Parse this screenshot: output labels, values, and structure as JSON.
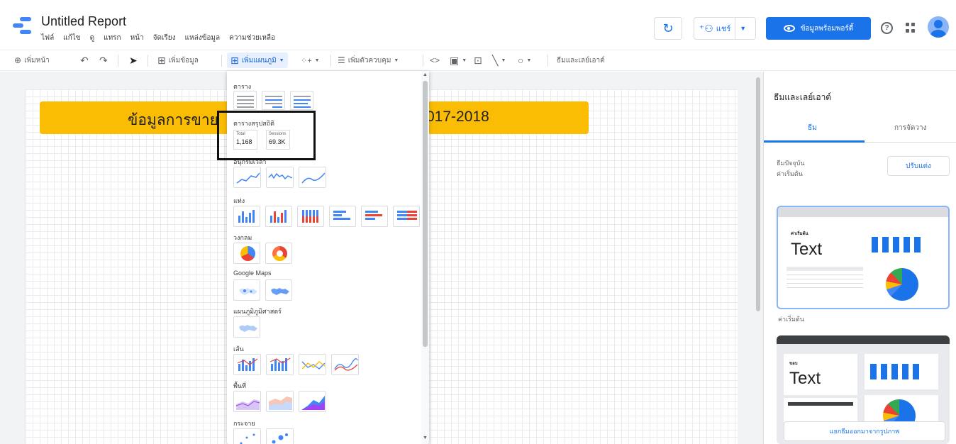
{
  "header": {
    "title": "Untitled Report",
    "menu": [
      "ไฟล์",
      "แก้ไข",
      "ดู",
      "แทรก",
      "หน้า",
      "จัดเรียง",
      "แหล่งข้อมูล",
      "ความช่วยเหลือ"
    ],
    "share_label": "แชร์",
    "view_label": "ข้อมูลพร้อมพอร์ตี้"
  },
  "toolbar": {
    "add_page": "เพิ่มหน้า",
    "add_data": "เพิ่มข้อมูล",
    "add_chart": "เพิ่มแผนภูมิ",
    "add_control": "เพิ่มตัวควบคุม",
    "theme_layout": "ธีมและเลย์เอาต์"
  },
  "canvas": {
    "banner_left": "ข้อมูลการขาย",
    "banner_right": "017-2018"
  },
  "chart_menu": {
    "sections": {
      "table": "ตาราง",
      "scorecard": "ตารางสรุปสถิติ",
      "timeseries": "อนุกรมเวลา",
      "bar": "แท่ง",
      "pie": "วงกลม",
      "google_maps": "Google Maps",
      "geo": "แผนภูมิภูมิศาสตร์",
      "line": "เส้น",
      "area": "พื้นที่",
      "scatter": "กระจาย"
    },
    "scorecard_1": {
      "label": "Total",
      "value": "1,168"
    },
    "scorecard_2": {
      "label": "Sessions",
      "value": "69.3K"
    }
  },
  "side_panel": {
    "title": "ธีมและเลย์เอาต์",
    "tab_theme": "ธีม",
    "tab_layout": "การจัดวาง",
    "current_theme_line1": "ธีมปัจจุบัน",
    "current_theme_line2": "ค่าเริ่มต้น",
    "customize": "ปรับแต่ง",
    "theme1_small": "ค่าเริ่มต้น",
    "theme1_text": "Text",
    "theme1_label": "ค่าเริ่มต้น",
    "theme2_small": "ขอบ",
    "theme2_text": "Text",
    "detach": "แยกธีมออกมาจากรูปภาพ"
  },
  "colors": {
    "accent": "#1a73e8",
    "banner": "#fbbc04"
  }
}
